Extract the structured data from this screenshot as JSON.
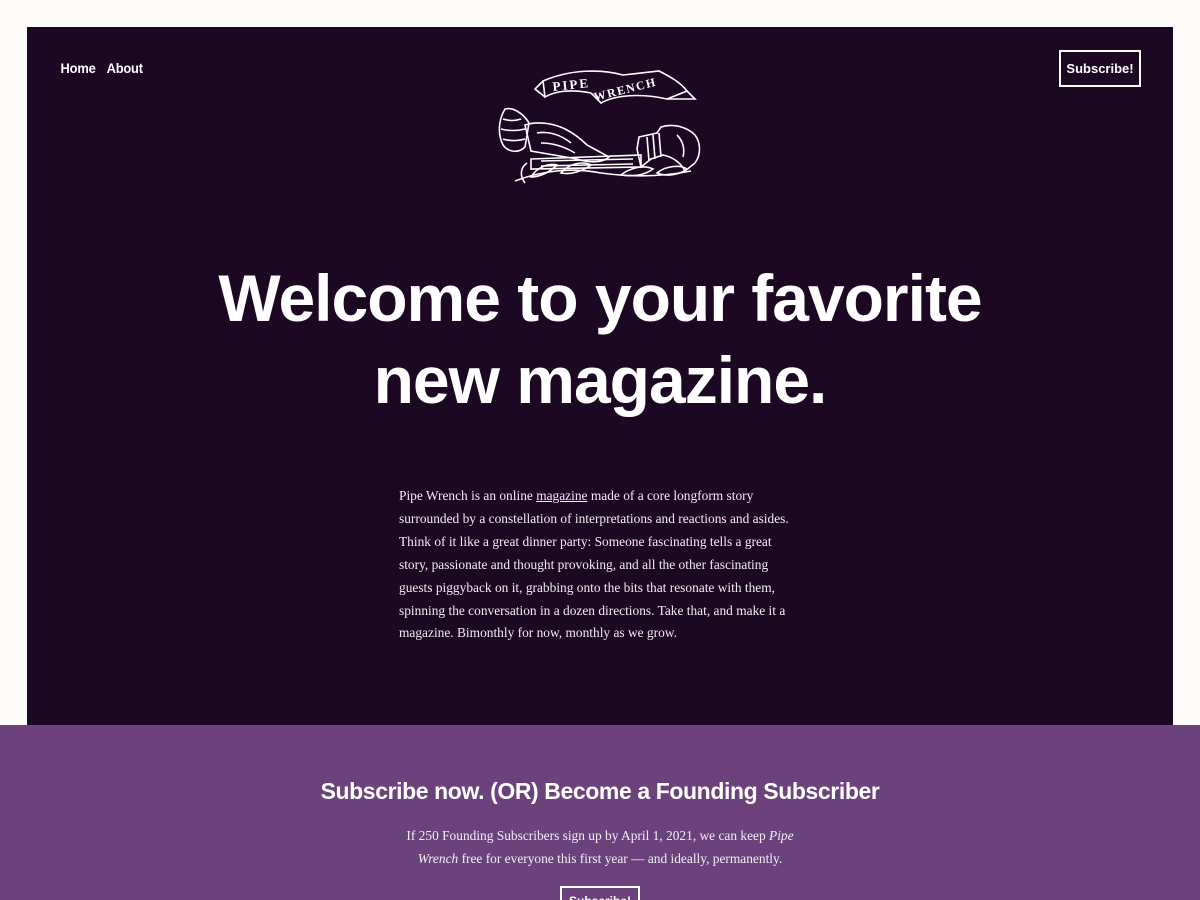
{
  "nav": {
    "home_label": "Home",
    "about_label": "About",
    "subscribe_label": "Subscribe!"
  },
  "logo": {
    "banner_text_1": "PIPE",
    "banner_text_2": "WRENCH"
  },
  "hero": {
    "headline_line1": "Welcome to your favorite",
    "headline_line2": "new magazine.",
    "intro_before": "Pipe Wrench is an online ",
    "intro_link": "magazine",
    "intro_after": " made of a core longform story surrounded by a constellation of interpretations and reactions and asides. Think of it like a great dinner party: Someone fascinating tells a great story, passionate and thought provoking, and all the other fascinating guests piggyback on it, grabbing onto the bits that resonate with them, spinning the conversation in a dozen directions. Take that, and make it a magazine. Bimonthly for now, monthly as we grow."
  },
  "subscribe_band": {
    "heading": "Subscribe now. (OR) Become a Founding Subscriber",
    "text_before": "If 250 Founding Subscribers sign up by April 1, 2021, we can keep ",
    "text_italic": "Pipe Wrench",
    "text_after": " free for everyone this first year — and ideally, permanently.",
    "button_label": "Subscribe!"
  },
  "colors": {
    "page_bg": "#fefcf9",
    "hero_bg": "#1c0823",
    "band_bg": "#6c427c",
    "text": "#ffffff"
  }
}
